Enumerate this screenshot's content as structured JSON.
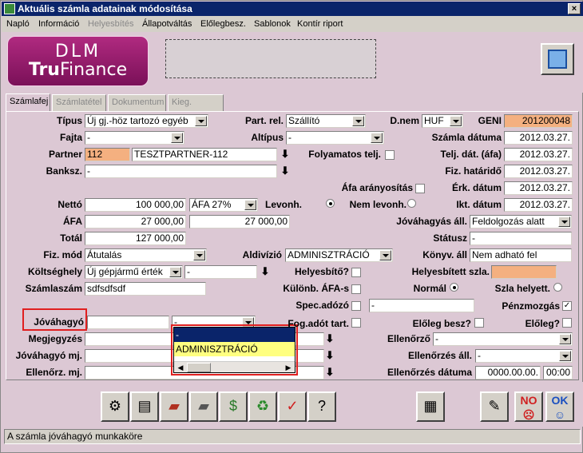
{
  "window": {
    "title": "Aktuális számla adatainak módosítása",
    "close_label": "×"
  },
  "menu": [
    "Napló",
    "Információ",
    "Helyesbítés",
    "Állapotváltás",
    "Előlegbesz.",
    "Sablonok",
    "Kontír riport"
  ],
  "logo": {
    "line1": "DLM",
    "line2a": "Tru",
    "line2b": "Finance"
  },
  "tabs": [
    "Számlafej",
    "Számlatétel",
    "Dokumentum",
    "Kieg. adatok"
  ],
  "labels": {
    "tipus": "Típus",
    "fajta": "Fajta",
    "partner": "Partner",
    "banksz": "Banksz.",
    "netto": "Nettó",
    "afa": "ÁFA",
    "total": "Totál",
    "fizmod": "Fiz. mód",
    "koltseghely": "Költséghely",
    "szamlaszam": "Számlaszám",
    "jovahagyo": "Jóváhagyó",
    "megjegyzes": "Megjegyzés",
    "jovahagyo_mj": "Jóváhagyó mj.",
    "ellenorz_mj": "Ellenőrz. mj.",
    "partrel": "Part. rel.",
    "altipus": "Altípus",
    "folyamatos": "Folyamatos telj.",
    "levonh": "Levonh.",
    "nemlevonh": "Nem levonh.",
    "aldivizio": "Aldivízió",
    "helyesbito": "Helyesbítő?",
    "kulonb": "Különb. ÁFA-s",
    "spec": "Spec.adózó",
    "fordadot": "Fog.adót tart.",
    "dnem": "D.nem",
    "geni": "GENI",
    "szamla_datuma": "Számla dátuma",
    "telj_dat": "Telj. dát. (áfa)",
    "fiz_hatarido": "Fiz. határidő",
    "afa_aranyositas": "Áfa arányosítás",
    "erk_datum": "Érk. dátum",
    "ikt_datum": "Ikt. dátum",
    "jovahagyas_all": "Jóváhagyás áll.",
    "statusz": "Státusz",
    "konyv_all": "Könyv. áll",
    "helyesbitett": "Helyesbített szla.",
    "normal": "Normál",
    "szla_helyett": "Szla helyett.",
    "penzmozgas": "Pénzmozgás",
    "eloleg_besz": "Előleg besz?",
    "eloleg": "Előleg?",
    "ellenorzo": "Ellenőrző",
    "ellenorzes_all": "Ellenőrzés áll.",
    "ellenorzes_datuma": "Ellenőrzés dátuma"
  },
  "values": {
    "tipus": "Új gj.-höz tartozó egyéb",
    "fajta": "-",
    "partner_code": "112",
    "partner_name": "TESZTPARTNER-112",
    "banksz": "-",
    "netto": "100 000,00",
    "afa_kulcs": "ÁFA 27%",
    "afa": "27 000,00",
    "afa2": "27 000,00",
    "total": "127 000,00",
    "fizmod": "Átutalás",
    "koltseghely": "Új gépjármű érték",
    "koltseghely2": "-",
    "szamlaszam": "sdfsdfsdf",
    "jovahagyo1": "",
    "jovahagyo2": "-",
    "partrel": "Szállító",
    "altipus": "-",
    "aldivizio": "ADMINISZTRÁCIÓ",
    "spec": "-",
    "dnem": "HUF",
    "geni": "201200048",
    "szamla_datuma": "2012.03.27.",
    "telj_dat": "2012.03.27.",
    "fiz_hatarido": "2012.03.27.",
    "erk_datum": "2012.03.27.",
    "ikt_datum": "2012.03.27.",
    "jovahagyas_all": "Feldolgozás alatt",
    "statusz": "-",
    "konyv_all": "Nem adható fel",
    "helyesbitett": "",
    "ellenorzo": "-",
    "ellenorzes_all": "-",
    "ellenorzes_datum": "0000.00.00.",
    "ellenorzes_ido": "00:00"
  },
  "dropdown_options": [
    "-",
    "ADMINISZTRÁCIÓ"
  ],
  "buttons": {
    "no": "NO",
    "ok": "OK"
  },
  "status": "A számla jóváhagyó munkaköre"
}
